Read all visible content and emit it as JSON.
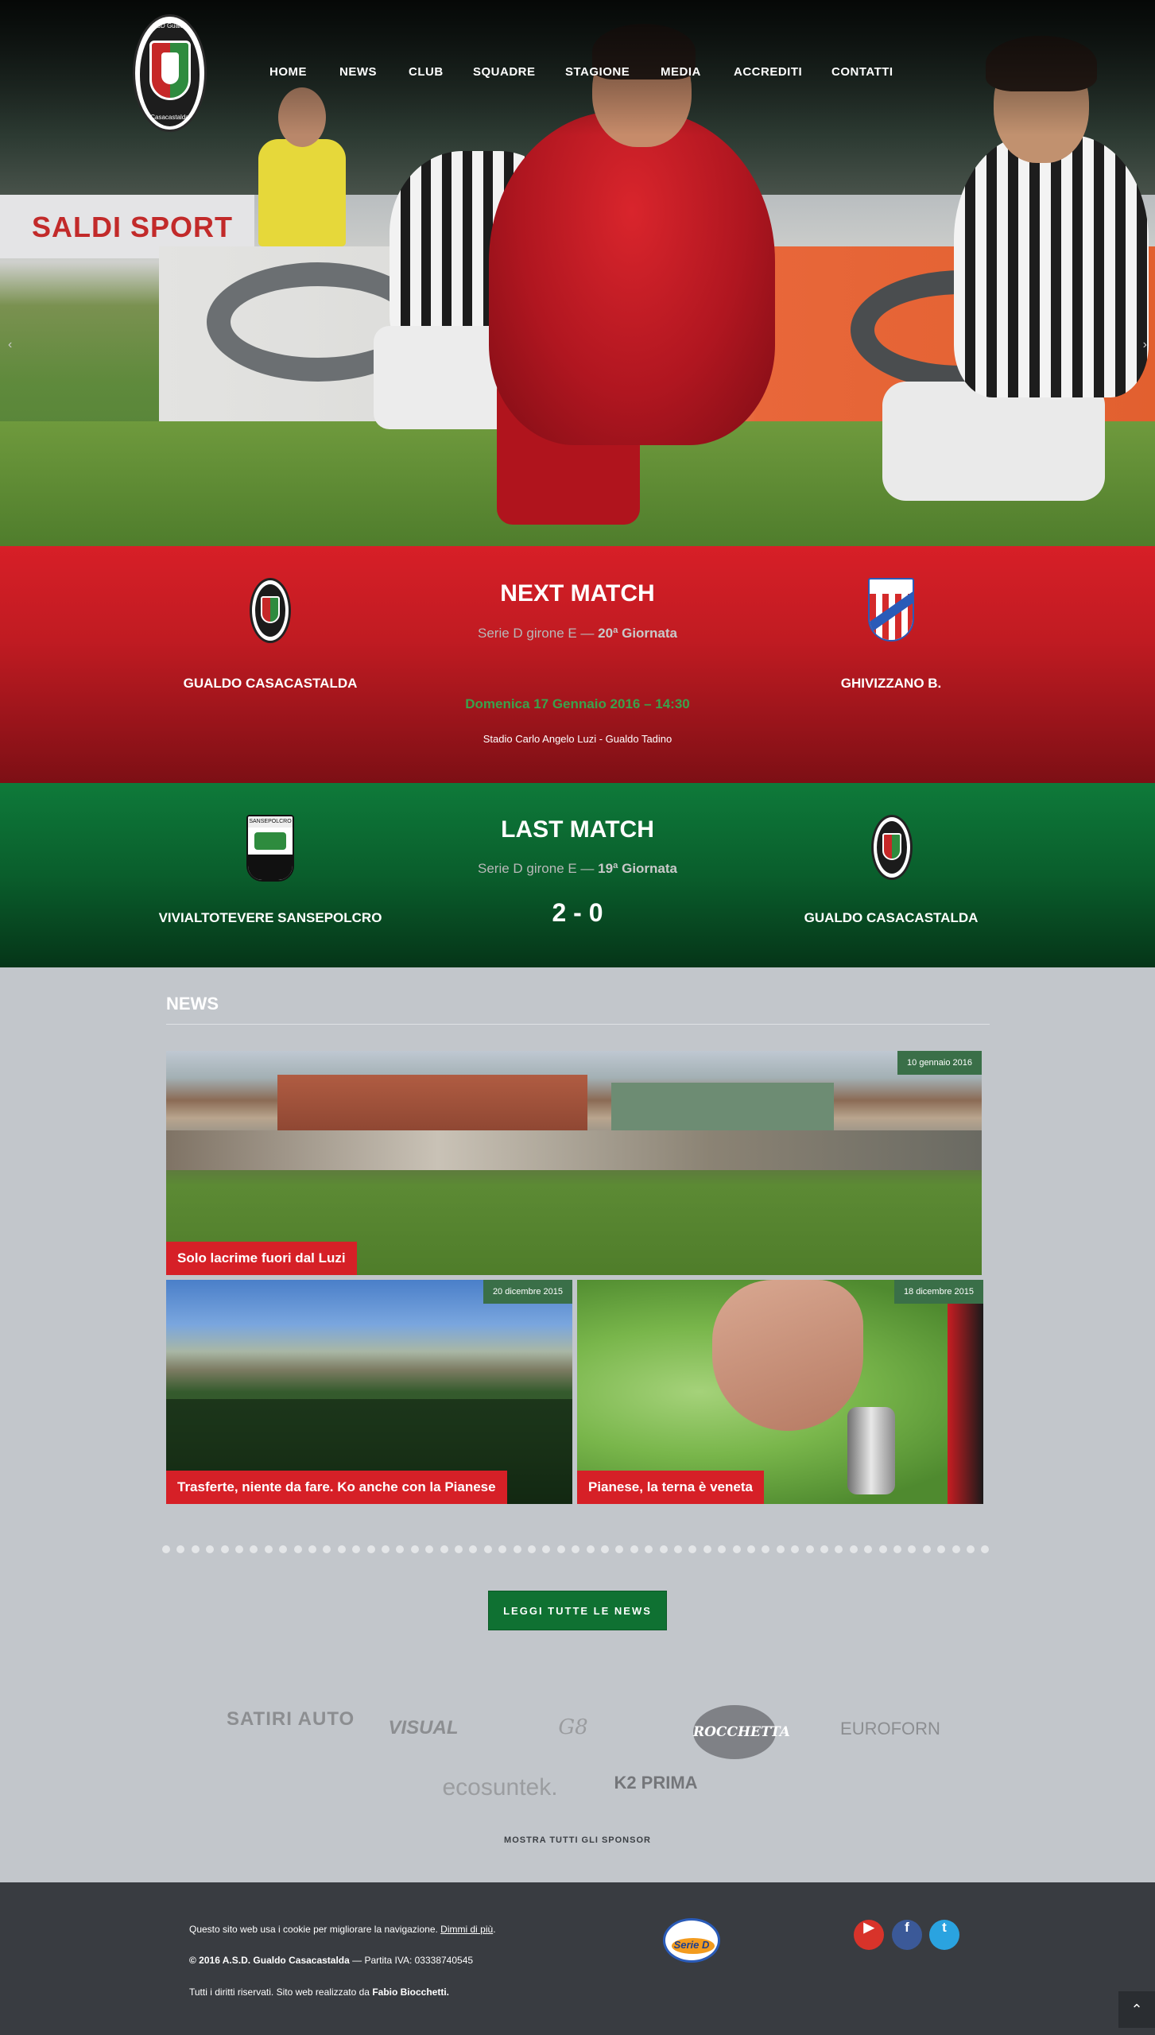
{
  "logo": {
    "top_text": "ASD Gualdo",
    "bottom_text": "Casacastalda"
  },
  "nav": [
    "HOME",
    "NEWS",
    "CLUB",
    "SQUADRE",
    "STAGIONE",
    "MEDIA",
    "ACCREDITI",
    "CONTATTI"
  ],
  "hero": {
    "arrow_prev": "‹",
    "arrow_next": "›",
    "banner_text": "SALDI SPORT"
  },
  "next_match": {
    "title": "NEXT MATCH",
    "league": "Serie D girone E — ",
    "round": "20ª Giornata",
    "home": "GUALDO CASACASTALDA",
    "away": "GHIVIZZANO B.",
    "datetime": "Domenica 17 Gennaio 2016 – 14:30",
    "venue": "Stadio Carlo Angelo Luzi - Gualdo Tadino"
  },
  "last_match": {
    "title": "LAST MATCH",
    "league": "Serie D girone E — ",
    "round": "19ª Giornata",
    "home": "VIVIALTOTEVERE SANSEPOLCRO",
    "away": "GUALDO CASACASTALDA",
    "score": "2 - 0",
    "home_crest_text": "SANSEPOLCRO"
  },
  "news": {
    "heading": "NEWS",
    "items": [
      {
        "title": "Solo lacrime fuori dal Luzi",
        "date": "10 gennaio 2016"
      },
      {
        "title": "Trasferte, niente da fare. Ko anche con la Pianese",
        "date": "20 dicembre 2015"
      },
      {
        "title": "Pianese, la terna è veneta",
        "date": "18 dicembre 2015"
      }
    ],
    "all_button": "LEGGI TUTTE LE NEWS"
  },
  "sponsors": {
    "logos": [
      "SATIRI AUTO",
      "VISUAL",
      "G8",
      "ROCCHETTA",
      "EUROFORN",
      "ecosuntek.",
      "K2 PRIMA"
    ],
    "show_all": "MOSTRA TUTTI GLI SPONSOR"
  },
  "footer": {
    "cookie_text": "Questo sito web usa i cookie per migliorare la navigazione. ",
    "cookie_link": "Dimmi di più",
    "copyright": "© 2016 A.S.D. Gualdo Casacastalda",
    "vat": " — Partita IVA: 03338740545",
    "rights": "Tutti i diritti riservati. Sito web realizzato da ",
    "author": "Fabio Biocchetti.",
    "league_logo": "Serie D",
    "social": [
      {
        "name": "youtube",
        "color": "#d8332a"
      },
      {
        "name": "facebook",
        "color": "#3b5998"
      },
      {
        "name": "twitter",
        "color": "#2aa3e0"
      }
    ],
    "to_top": "⌃"
  }
}
